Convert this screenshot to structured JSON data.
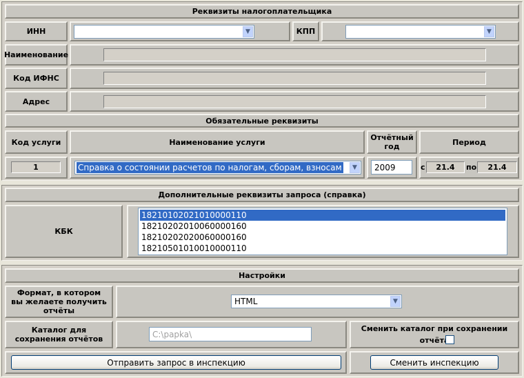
{
  "taxpayer": {
    "section_title": "Реквизиты налогоплательщика",
    "inn_label": "ИНН",
    "inn_value": "",
    "kpp_label": "КПП",
    "kpp_value": "",
    "name_label": "Наименование",
    "ifns_label": "Код ИФНС",
    "address_label": "Адрес"
  },
  "required": {
    "section_title": "Обязательные реквизиты",
    "service_code_header": "Код услуги",
    "service_name_header": "Наименование услуги",
    "report_year_header": "Отчётный год",
    "period_header": "Период",
    "service_code_value": "1",
    "service_name_value": "Справка о состоянии расчетов по налогам, сборам, взносам",
    "report_year_value": "2009",
    "period_from_label": "с",
    "period_from_value": "21.4",
    "period_to_label": "по",
    "period_to_value": "21.4"
  },
  "additional": {
    "section_title": "Дополнительные реквизиты запроса (справка)",
    "kbk_label": "КБК",
    "kbk_items": [
      "18210102021010000110",
      "18210202010060000160",
      "18210202020060000160",
      "18210501010010000110"
    ]
  },
  "settings": {
    "section_title": "Настройки",
    "format_label": "Формат, в котором вы желаете получить отчёты",
    "format_value": "HTML",
    "folder_label": "Каталог для сохранения отчётов",
    "folder_value": "C:\\papka\\",
    "change_folder_label": "Сменить каталог при сохранении отчёта",
    "change_folder_checked": false,
    "send_button": "Отправить запрос в инспекцию",
    "change_inspection_button": "Сменить инспекцию"
  },
  "colors": {
    "background": "#e8e6da",
    "cell": "#c8c6c0",
    "selection": "#316ac5",
    "combo_arrow": "#c1d3fb"
  }
}
